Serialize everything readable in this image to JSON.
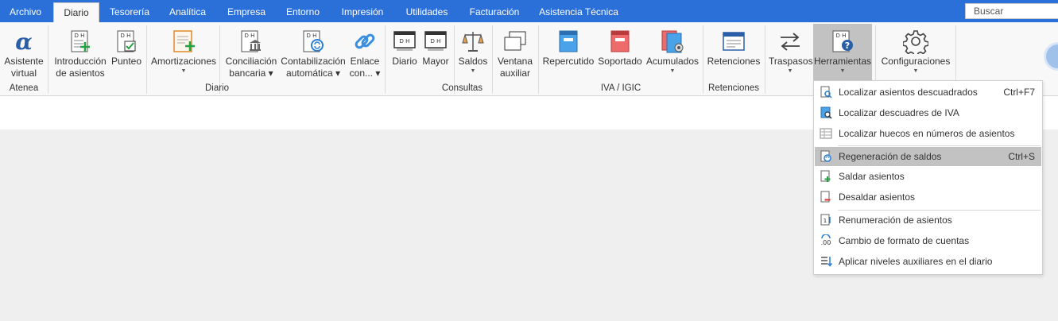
{
  "menu": {
    "tabs": [
      {
        "label": "Archivo"
      },
      {
        "label": "Diario"
      },
      {
        "label": "Tesorería"
      },
      {
        "label": "Analítica"
      },
      {
        "label": "Empresa"
      },
      {
        "label": "Entorno"
      },
      {
        "label": "Impresión"
      },
      {
        "label": "Utilidades"
      },
      {
        "label": "Facturación"
      },
      {
        "label": "Asistencia Técnica"
      }
    ],
    "active_tab": "Diario",
    "search_placeholder": "Buscar"
  },
  "ribbon": {
    "buttons": {
      "asistente": {
        "line1": "Asistente",
        "line2": "virtual"
      },
      "introduccion": {
        "line1": "Introducción",
        "line2": "de asientos"
      },
      "punteo": {
        "line1": "Punteo"
      },
      "amortizaciones": {
        "line1": "Amortizaciones"
      },
      "conciliacion": {
        "line1": "Conciliación",
        "line2": "bancaria"
      },
      "contabilizacion": {
        "line1": "Contabilización",
        "line2": "automática"
      },
      "enlace": {
        "line1": "Enlace",
        "line2": "con..."
      },
      "diario": {
        "line1": "Diario"
      },
      "mayor": {
        "line1": "Mayor"
      },
      "saldos": {
        "line1": "Saldos"
      },
      "ventana": {
        "line1": "Ventana",
        "line2": "auxiliar"
      },
      "repercutido": {
        "line1": "Repercutido"
      },
      "soportado": {
        "line1": "Soportado"
      },
      "acumulados": {
        "line1": "Acumulados"
      },
      "retenciones": {
        "line1": "Retenciones"
      },
      "traspasos": {
        "line1": "Traspasos"
      },
      "herramientas": {
        "line1": "Herramientas"
      },
      "configuraciones": {
        "line1": "Configuraciones"
      }
    },
    "groups": {
      "atenea": "Atenea",
      "diario": "Diario",
      "consultas": "Consultas",
      "iva": "IVA / IGIC",
      "retenciones": "Retenciones"
    },
    "icon_tag": "D H"
  },
  "dropdown": {
    "items": [
      {
        "label": "Localizar asientos descuadrados",
        "shortcut": "Ctrl+F7",
        "icon": "search-doc-icon"
      },
      {
        "label": "Localizar descuadres de IVA",
        "shortcut": "",
        "icon": "search-vat-icon"
      },
      {
        "label": "Localizar huecos en números de asientos",
        "shortcut": "",
        "icon": "grid-gap-icon"
      },
      {
        "label": "Regeneración de saldos",
        "shortcut": "Ctrl+S",
        "icon": "regenerate-icon"
      },
      {
        "label": "Saldar asientos",
        "shortcut": "",
        "icon": "settle-icon"
      },
      {
        "label": "Desaldar asientos",
        "shortcut": "",
        "icon": "unsettle-icon"
      },
      {
        "label": "Renumeración de asientos",
        "shortcut": "",
        "icon": "renumber-icon"
      },
      {
        "label": "Cambio de formato de cuentas",
        "shortcut": "",
        "icon": "format-icon"
      },
      {
        "label": "Aplicar niveles auxiliares en el diario",
        "shortcut": "",
        "icon": "levels-icon"
      }
    ],
    "highlighted_index": 3
  },
  "colors": {
    "menubar": "#2b6fd8",
    "accent_green": "#23a344",
    "accent_blue": "#2a7fd4",
    "highlight": "#c2c2c2"
  }
}
